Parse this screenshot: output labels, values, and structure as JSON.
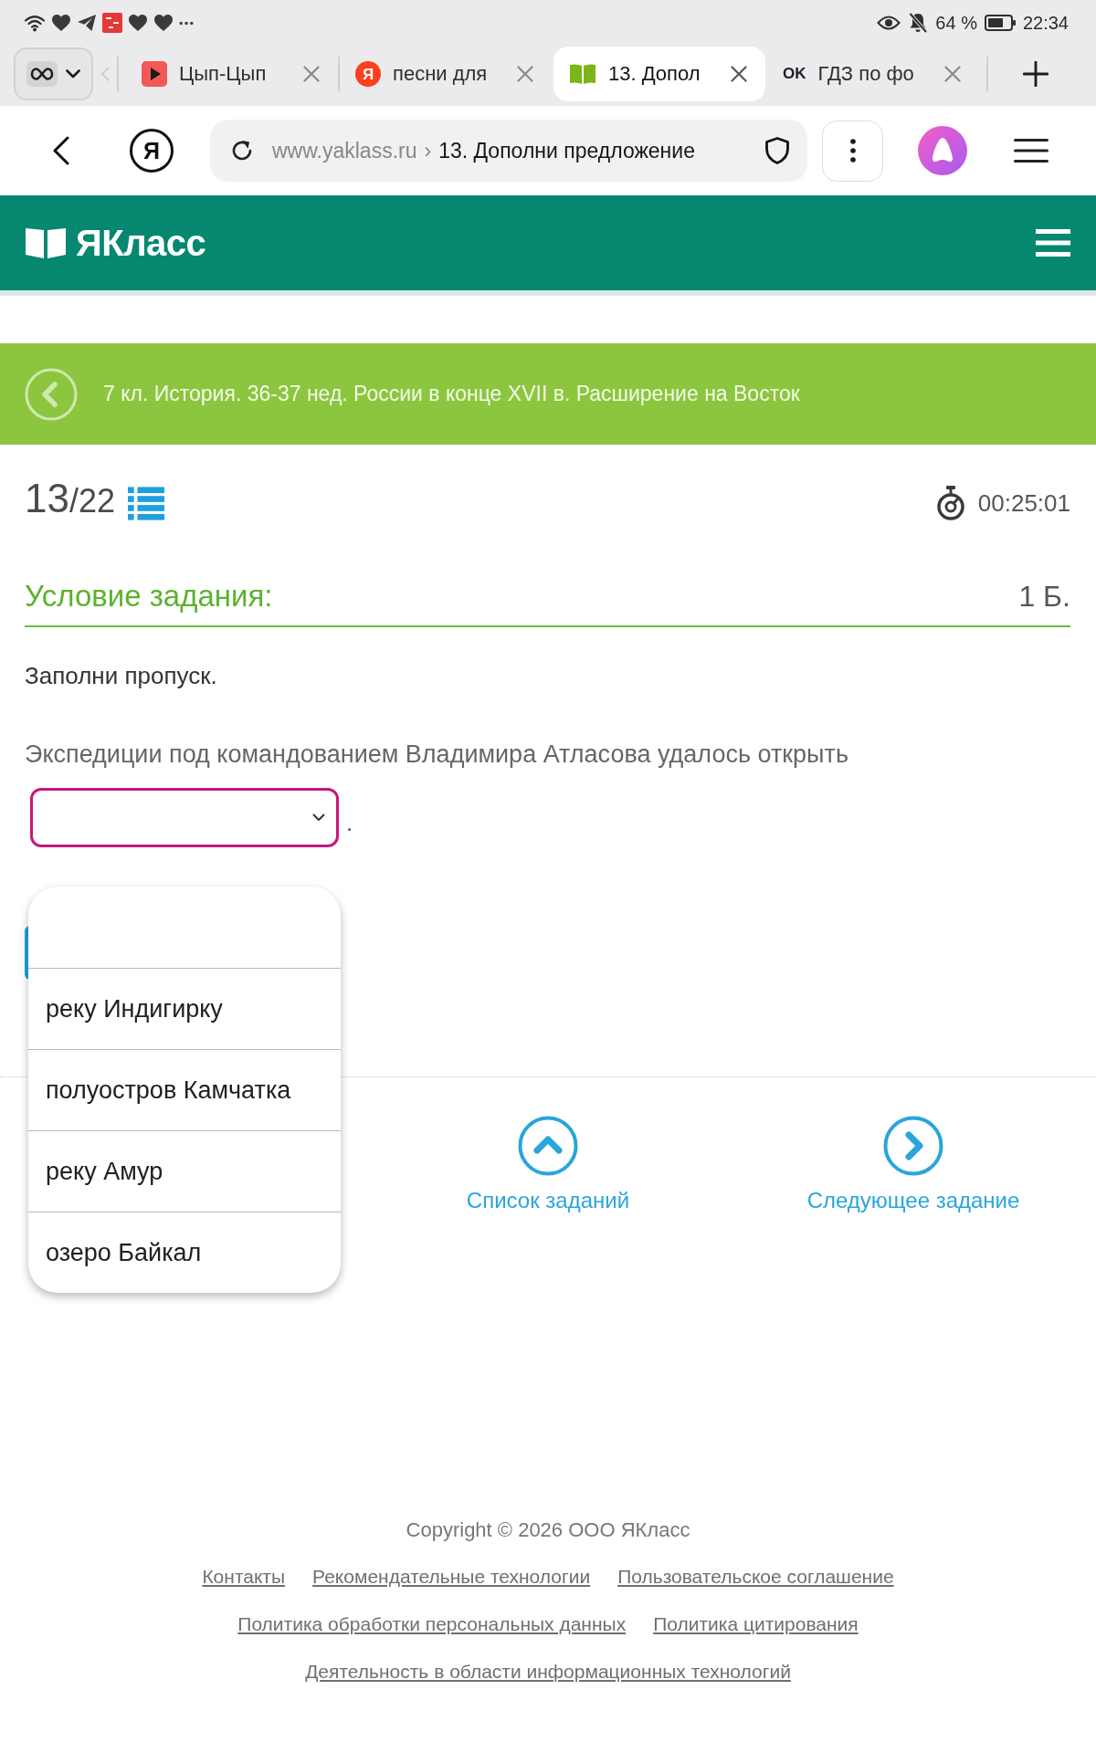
{
  "status_bar": {
    "battery_text": "64 %",
    "time": "22:34"
  },
  "browser": {
    "tabs": [
      {
        "title": "Цып-Цып",
        "kind": "play-tile",
        "selected": false
      },
      {
        "title": "песни для",
        "kind": "letter-disc",
        "icon_text": "Я",
        "selected": false
      },
      {
        "title": "13. Допол",
        "kind": "book",
        "selected": true
      },
      {
        "title": "ГДЗ по фо",
        "kind": "text-mark",
        "icon_text": "OK",
        "selected": false
      }
    ],
    "home_button_text": "Я",
    "address": {
      "domain": "www.yaklass.ru",
      "separator": "›",
      "page_title": "13. Дополни предложение"
    }
  },
  "site_header": {
    "logo_text": "ЯКласс"
  },
  "banner": {
    "text": "7 кл. История. 36-37 нед. России в конце XVII в. Расширение на Восток"
  },
  "task": {
    "counter": "13",
    "total": "/22",
    "timer": "00:25:01",
    "heading": "Условие задания:",
    "points": "1 Б.",
    "instruction": "Заполни пропуск.",
    "sentence": "Экспедиции под командованием Владимира Атласова удалось открыть",
    "after_blank": "."
  },
  "dropdown": {
    "expanded": true,
    "options": [
      {
        "label": "реку Индигирку"
      },
      {
        "label": "полуостров Камчатка"
      },
      {
        "label": "реку Амур"
      },
      {
        "label": "озеро Байкал"
      }
    ]
  },
  "navigation": [
    {
      "label": "Список заданий",
      "kind": "up"
    },
    {
      "label": "Следующее задание",
      "kind": "right"
    }
  ],
  "footer": {
    "copyright": "Copyright © 2026 ООО ЯКласс",
    "link_rows": [
      [
        "Контакты",
        "Рекомендательные технологии",
        "Пользовательское соглашение"
      ],
      [
        "Политика обработки персональных данных",
        "Политика цитирования"
      ],
      [
        "Деятельность в области информационных технологий"
      ]
    ]
  }
}
